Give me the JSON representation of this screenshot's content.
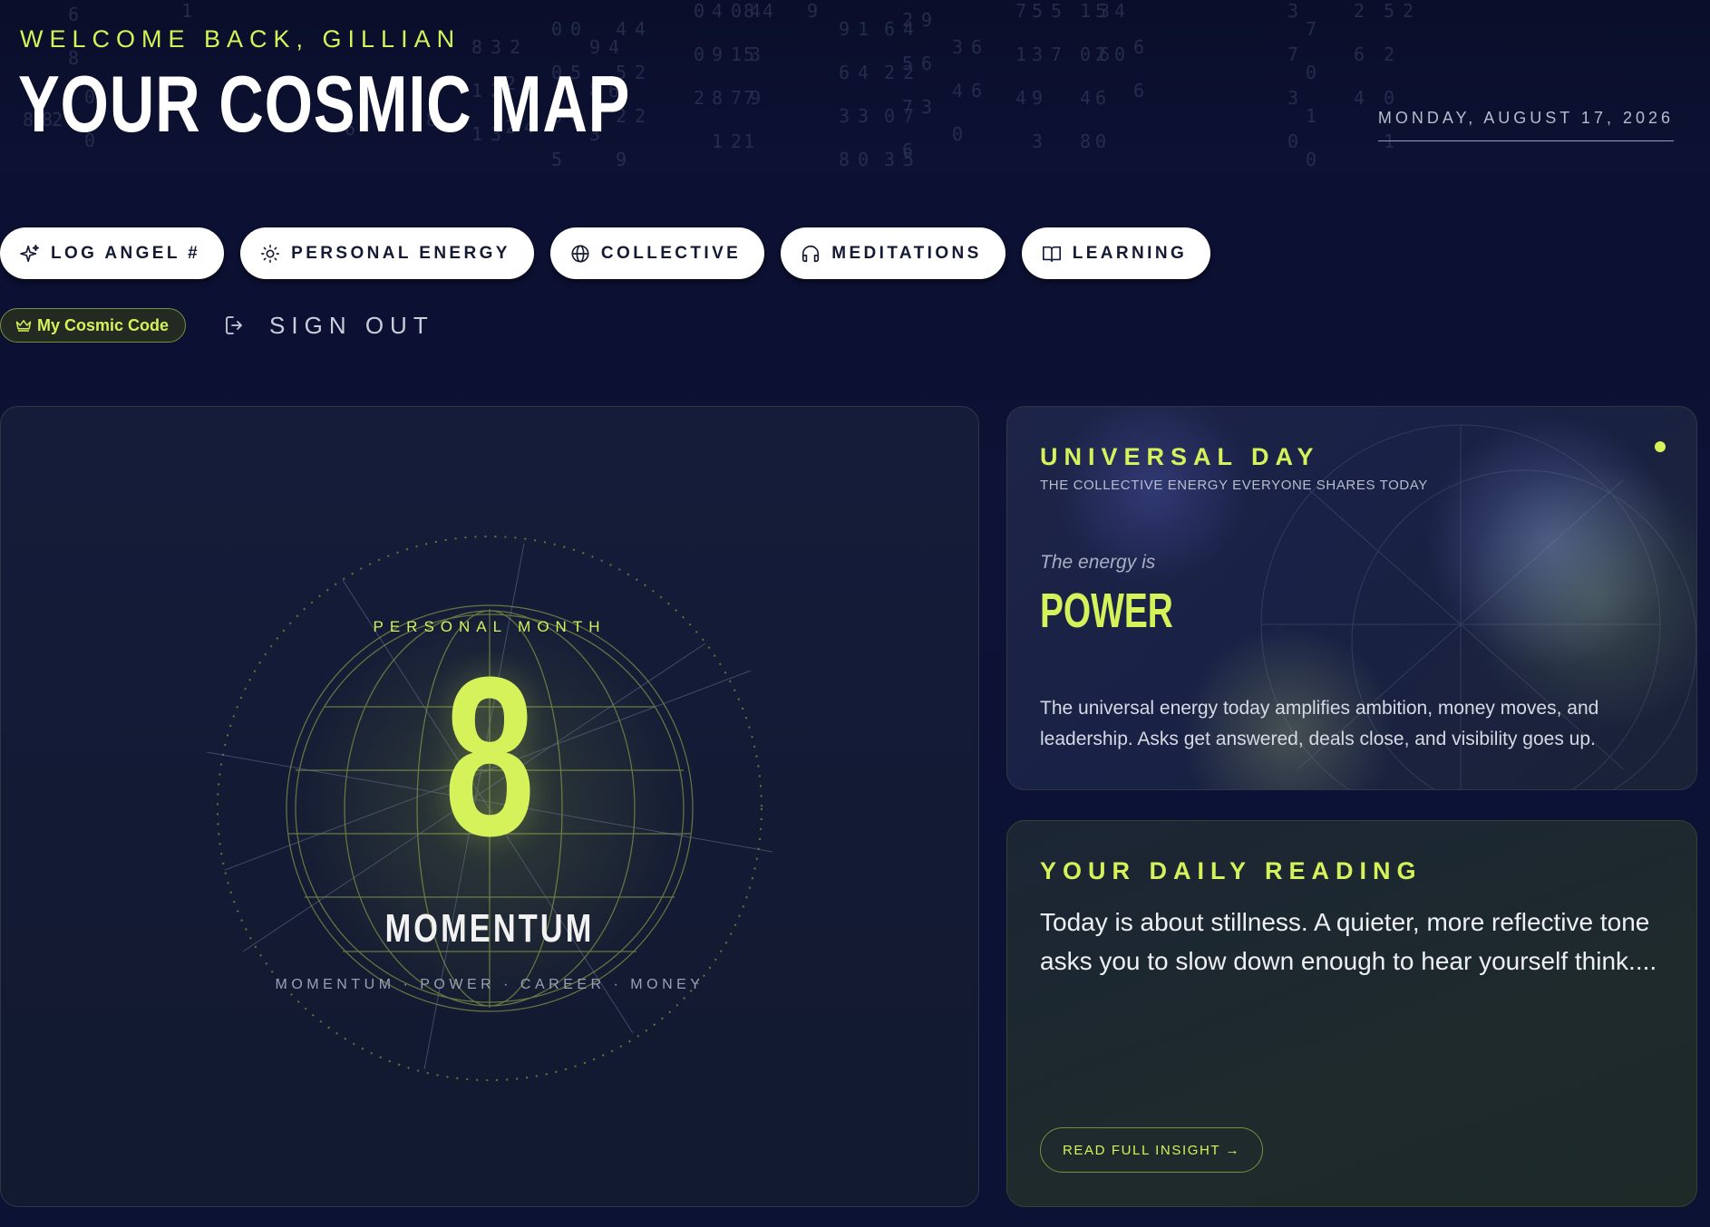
{
  "header": {
    "welcome": "WELCOME BACK, GILLIAN",
    "title": "YOUR COSMIC MAP",
    "date": "MONDAY, AUGUST 17, 2026"
  },
  "nav": [
    {
      "label": "LOG ANGEL #",
      "icon": "sparkle-icon"
    },
    {
      "label": "PERSONAL ENERGY",
      "icon": "sun-icon"
    },
    {
      "label": "COLLECTIVE",
      "icon": "globe-icon"
    },
    {
      "label": "MEDITATIONS",
      "icon": "headphones-icon"
    },
    {
      "label": "LEARNING",
      "icon": "book-icon"
    }
  ],
  "account": {
    "cosmic_code": "My Cosmic Code",
    "sign_out": "SIGN OUT"
  },
  "personal_month": {
    "label": "PERSONAL MONTH",
    "number": "8",
    "theme": "MOMENTUM",
    "keywords": "MOMENTUM · POWER · CAREER · MONEY"
  },
  "universal_day": {
    "title": "UNIVERSAL DAY",
    "subtitle": "THE COLLECTIVE ENERGY EVERYONE SHARES TODAY",
    "energy_intro": "The energy is",
    "energy": "POWER",
    "description": "The universal energy today amplifies ambition, money moves, and leadership. Asks get answered, deals close, and visibility goes up."
  },
  "daily_reading": {
    "title": "YOUR DAILY READING",
    "text": "Today is about stillness. A quieter, more reflective tone asks you to slow down enough to hear yourself think....",
    "button": "READ FULL INSIGHT →"
  },
  "colors": {
    "accent": "#d6f25a",
    "background": "#0d1236"
  }
}
